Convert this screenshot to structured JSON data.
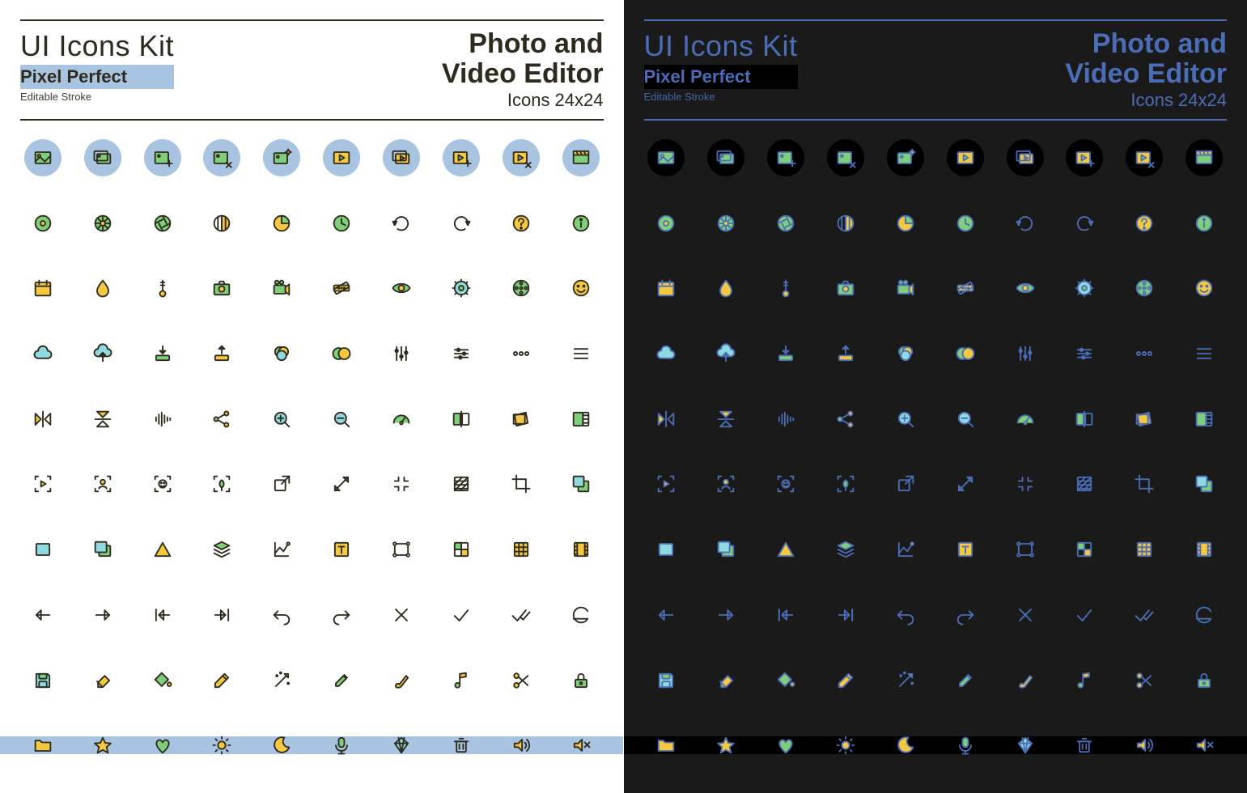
{
  "header": {
    "kit_title": "UI Icons Kit",
    "pixel": "Pixel Perfect",
    "stroke": "Editable Stroke",
    "main_line1": "Photo and",
    "main_line2": "Video Editor",
    "sub": "Icons 24x24"
  },
  "colors": {
    "green": "#7fcf7a",
    "yellow": "#f5c842",
    "teal": "#8fd9e0",
    "blue": "#4a6db5",
    "dark_stroke": "#2e2a1e"
  },
  "icons": [
    [
      "image",
      "image-stack",
      "image-add",
      "image-remove",
      "image-sparkle",
      "video",
      "video-stack",
      "video-add",
      "video-remove",
      "clapperboard"
    ],
    [
      "record-dot",
      "color-wheel",
      "aperture",
      "contrast",
      "time-elapsed",
      "clock",
      "rotate-ccw",
      "rotate-cw",
      "help",
      "info"
    ],
    [
      "calendar",
      "droplet",
      "thermometer",
      "camera",
      "video-camera",
      "bandage",
      "eye",
      "settings-gear",
      "film-reel",
      "smile"
    ],
    [
      "cloud",
      "cloud-upload",
      "download-tray",
      "upload-tray",
      "color-channels",
      "blend",
      "sliders-v",
      "sliders-h",
      "more-h",
      "menu"
    ],
    [
      "flip-h",
      "flip-v",
      "audio-wave",
      "share-nodes",
      "zoom-in",
      "zoom-out",
      "gauge",
      "compare-split",
      "skew",
      "resize-frame"
    ],
    [
      "play-focus",
      "portrait-focus",
      "face-focus",
      "macro-focus",
      "external-link",
      "expand-diag",
      "collapse",
      "texture-hatch",
      "crop",
      "layer-top"
    ],
    [
      "rectangle",
      "rectangles",
      "triangle",
      "layers",
      "line-chart",
      "text-box",
      "vector-path",
      "grid-2",
      "grid-3",
      "film-strip"
    ],
    [
      "arrow-left",
      "arrow-right",
      "arrow-start",
      "arrow-end",
      "undo",
      "redo",
      "close-x",
      "check",
      "check-all",
      "revert"
    ],
    [
      "save-floppy",
      "eraser",
      "paint-bucket",
      "pencil",
      "magic-wand",
      "eyedropper",
      "brush",
      "music-note",
      "scissors",
      "lock"
    ],
    [
      "folder",
      "star",
      "heart",
      "sun",
      "moon",
      "microphone",
      "diamond",
      "trash",
      "volume",
      "volume-mute"
    ]
  ]
}
